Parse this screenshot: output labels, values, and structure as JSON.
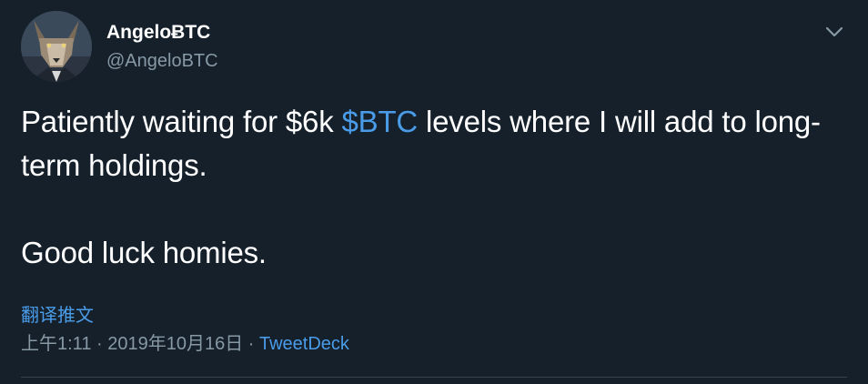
{
  "tweet": {
    "author": {
      "display_name": "AngeloɃTC",
      "handle": "@AngeloBTC",
      "avatar_icon": "wolf-avatar-icon"
    },
    "menu_icon": "chevron-down-icon",
    "text": {
      "line1_before": "Patiently waiting for $6k ",
      "cashtag": "$BTC",
      "line1_after": " levels where I will add to long-term holdings.",
      "line2": "Good luck homies."
    },
    "translate_label": "翻译推文",
    "timestamp": "上午1:11 · 2019年10月16日",
    "separator": " · ",
    "source": "TweetDeck"
  },
  "colors": {
    "background": "#15202b",
    "text_primary": "#ffffff",
    "text_secondary": "#8899a6",
    "accent": "#4a9ce8",
    "divider": "#38444d"
  }
}
